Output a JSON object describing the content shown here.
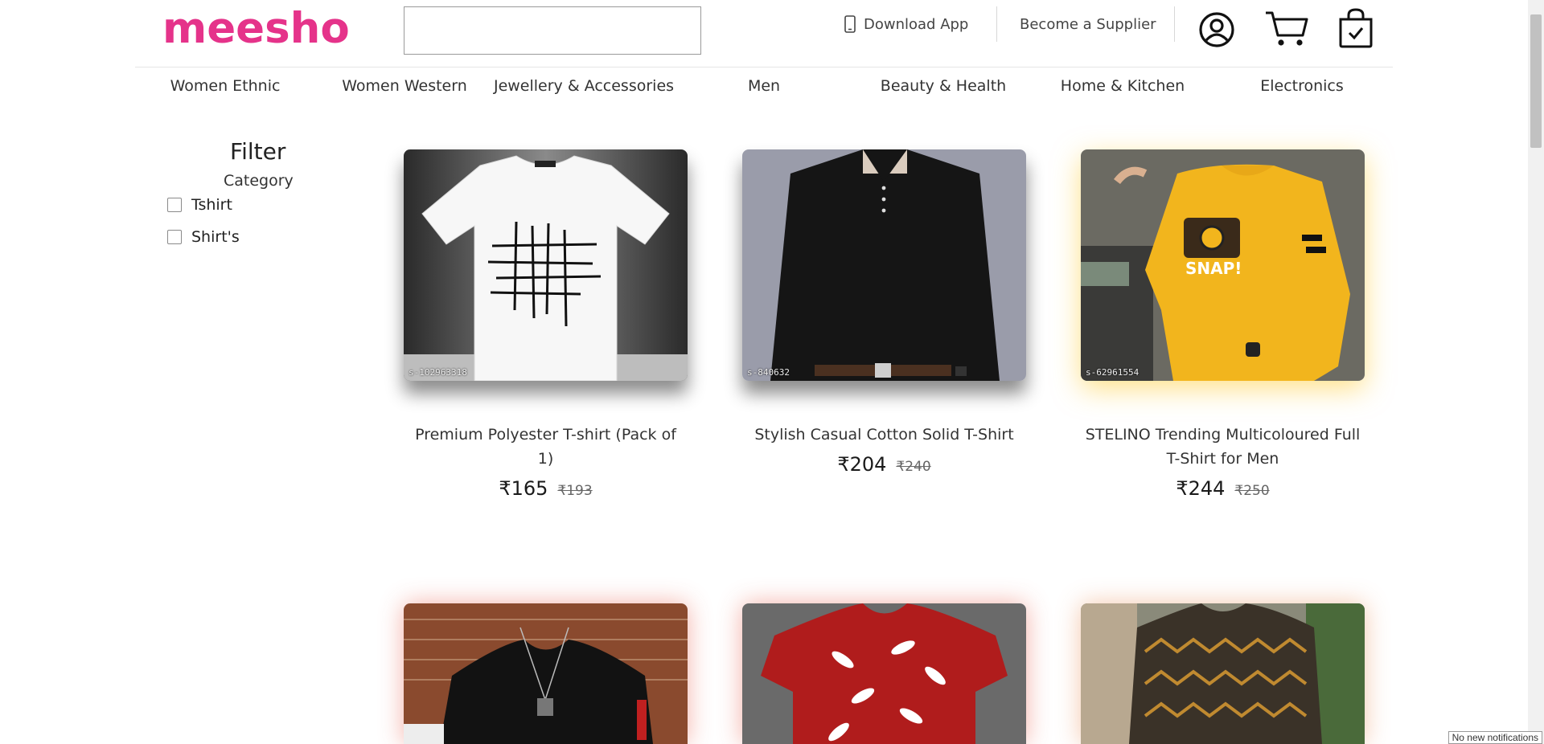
{
  "header": {
    "logo": "meesho",
    "search": {
      "value": "",
      "placeholder": ""
    },
    "download_app": "Download App",
    "become_supplier": "Become a Supplier",
    "icons": [
      "profile-icon",
      "cart-icon",
      "shopping-bag-icon"
    ]
  },
  "nav": {
    "items": [
      {
        "label": "Women Ethnic"
      },
      {
        "label": "Women Western"
      },
      {
        "label": "Jewellery & Accessories"
      },
      {
        "label": "Men"
      },
      {
        "label": "Beauty & Health"
      },
      {
        "label": "Home & Kitchen"
      },
      {
        "label": "Electronics"
      }
    ]
  },
  "filter": {
    "title": "Filter",
    "category_label": "Category",
    "options": [
      {
        "label": "Tshirt",
        "checked": false
      },
      {
        "label": "Shirt's",
        "checked": false
      }
    ]
  },
  "products": [
    {
      "sku": "s-102963318",
      "title": "Premium Polyester T-shirt (Pack of 1)",
      "price": "₹165",
      "old_price": "₹193"
    },
    {
      "sku": "s-840632",
      "title": "Stylish Casual Cotton Solid T-Shirt",
      "price": "₹204",
      "old_price": "₹240"
    },
    {
      "sku": "s-62961554",
      "title": "STELINO Trending Multicoloured Full T-Shirt for Men",
      "price": "₹244",
      "old_price": "₹250"
    },
    {
      "sku": "",
      "title": "",
      "price": "",
      "old_price": ""
    },
    {
      "sku": "",
      "title": "",
      "price": "",
      "old_price": ""
    },
    {
      "sku": "",
      "title": "",
      "price": "",
      "old_price": ""
    }
  ],
  "notification": "No new notifications",
  "colors": {
    "brand": "#e5338a"
  }
}
